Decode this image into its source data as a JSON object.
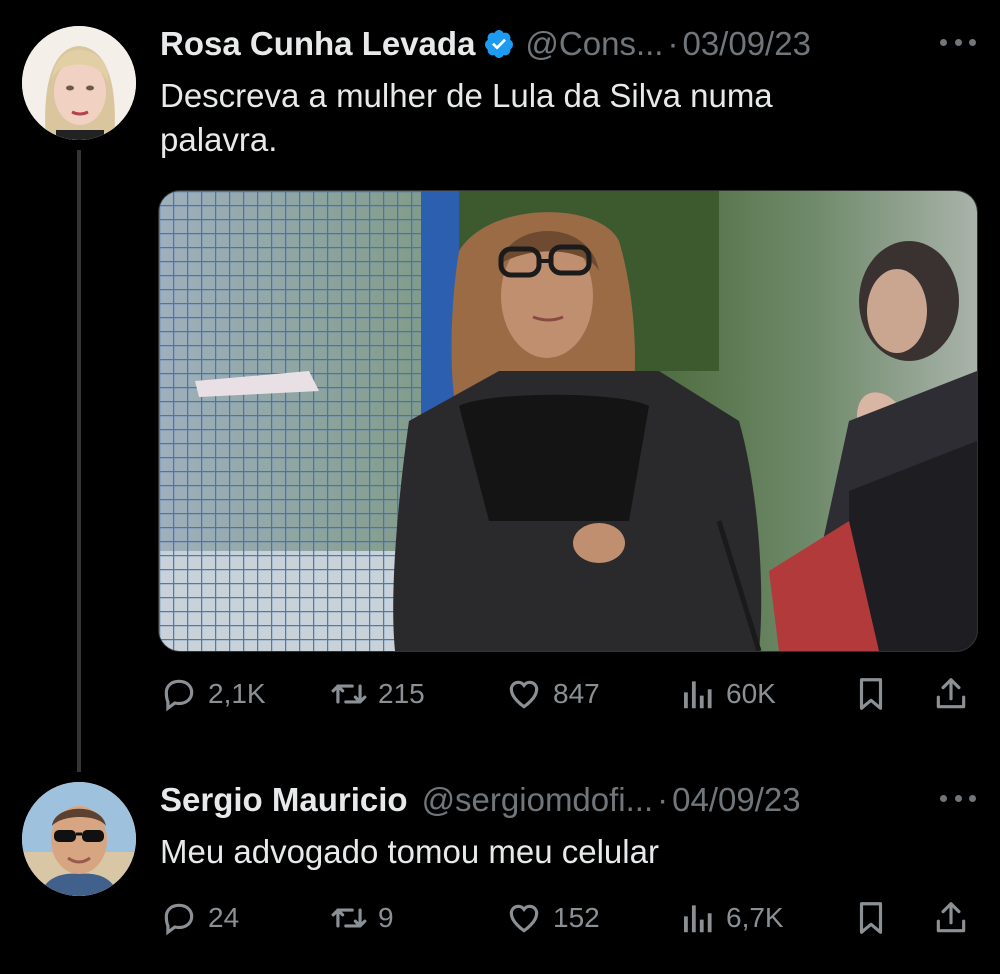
{
  "tweets": [
    {
      "name": "Rosa Cunha Levada",
      "verified": true,
      "handle": "@Cons...",
      "separator": "·",
      "date": "03/09/23",
      "text_line1": "Descreva a mulher de Lula da Silva numa",
      "text_line2": "palavra.",
      "has_media": true,
      "stats": {
        "replies": "2,1K",
        "retweets": "215",
        "likes": "847",
        "views": "60K"
      }
    },
    {
      "name": "Sergio Mauricio",
      "verified": false,
      "handle": "@sergiomdofi...",
      "separator": "·",
      "date": "04/09/23",
      "text_line1": "Meu advogado tomou meu celular",
      "has_media": false,
      "stats": {
        "replies": "24",
        "retweets": "9",
        "likes": "152",
        "views": "6,7K"
      }
    }
  ],
  "icons": {
    "reply": "speech-bubble-icon",
    "retweet": "retweet-arrows-icon",
    "like": "heart-icon",
    "views": "bar-chart-icon",
    "bookmark": "bookmark-icon",
    "share": "share-upload-icon",
    "verified": "blue-check-badge-icon",
    "more": "ellipsis-icon"
  },
  "colors": {
    "background": "#000000",
    "text": "#e7e9ea",
    "muted": "#71767b",
    "verified_blue": "#1d9bf0"
  }
}
